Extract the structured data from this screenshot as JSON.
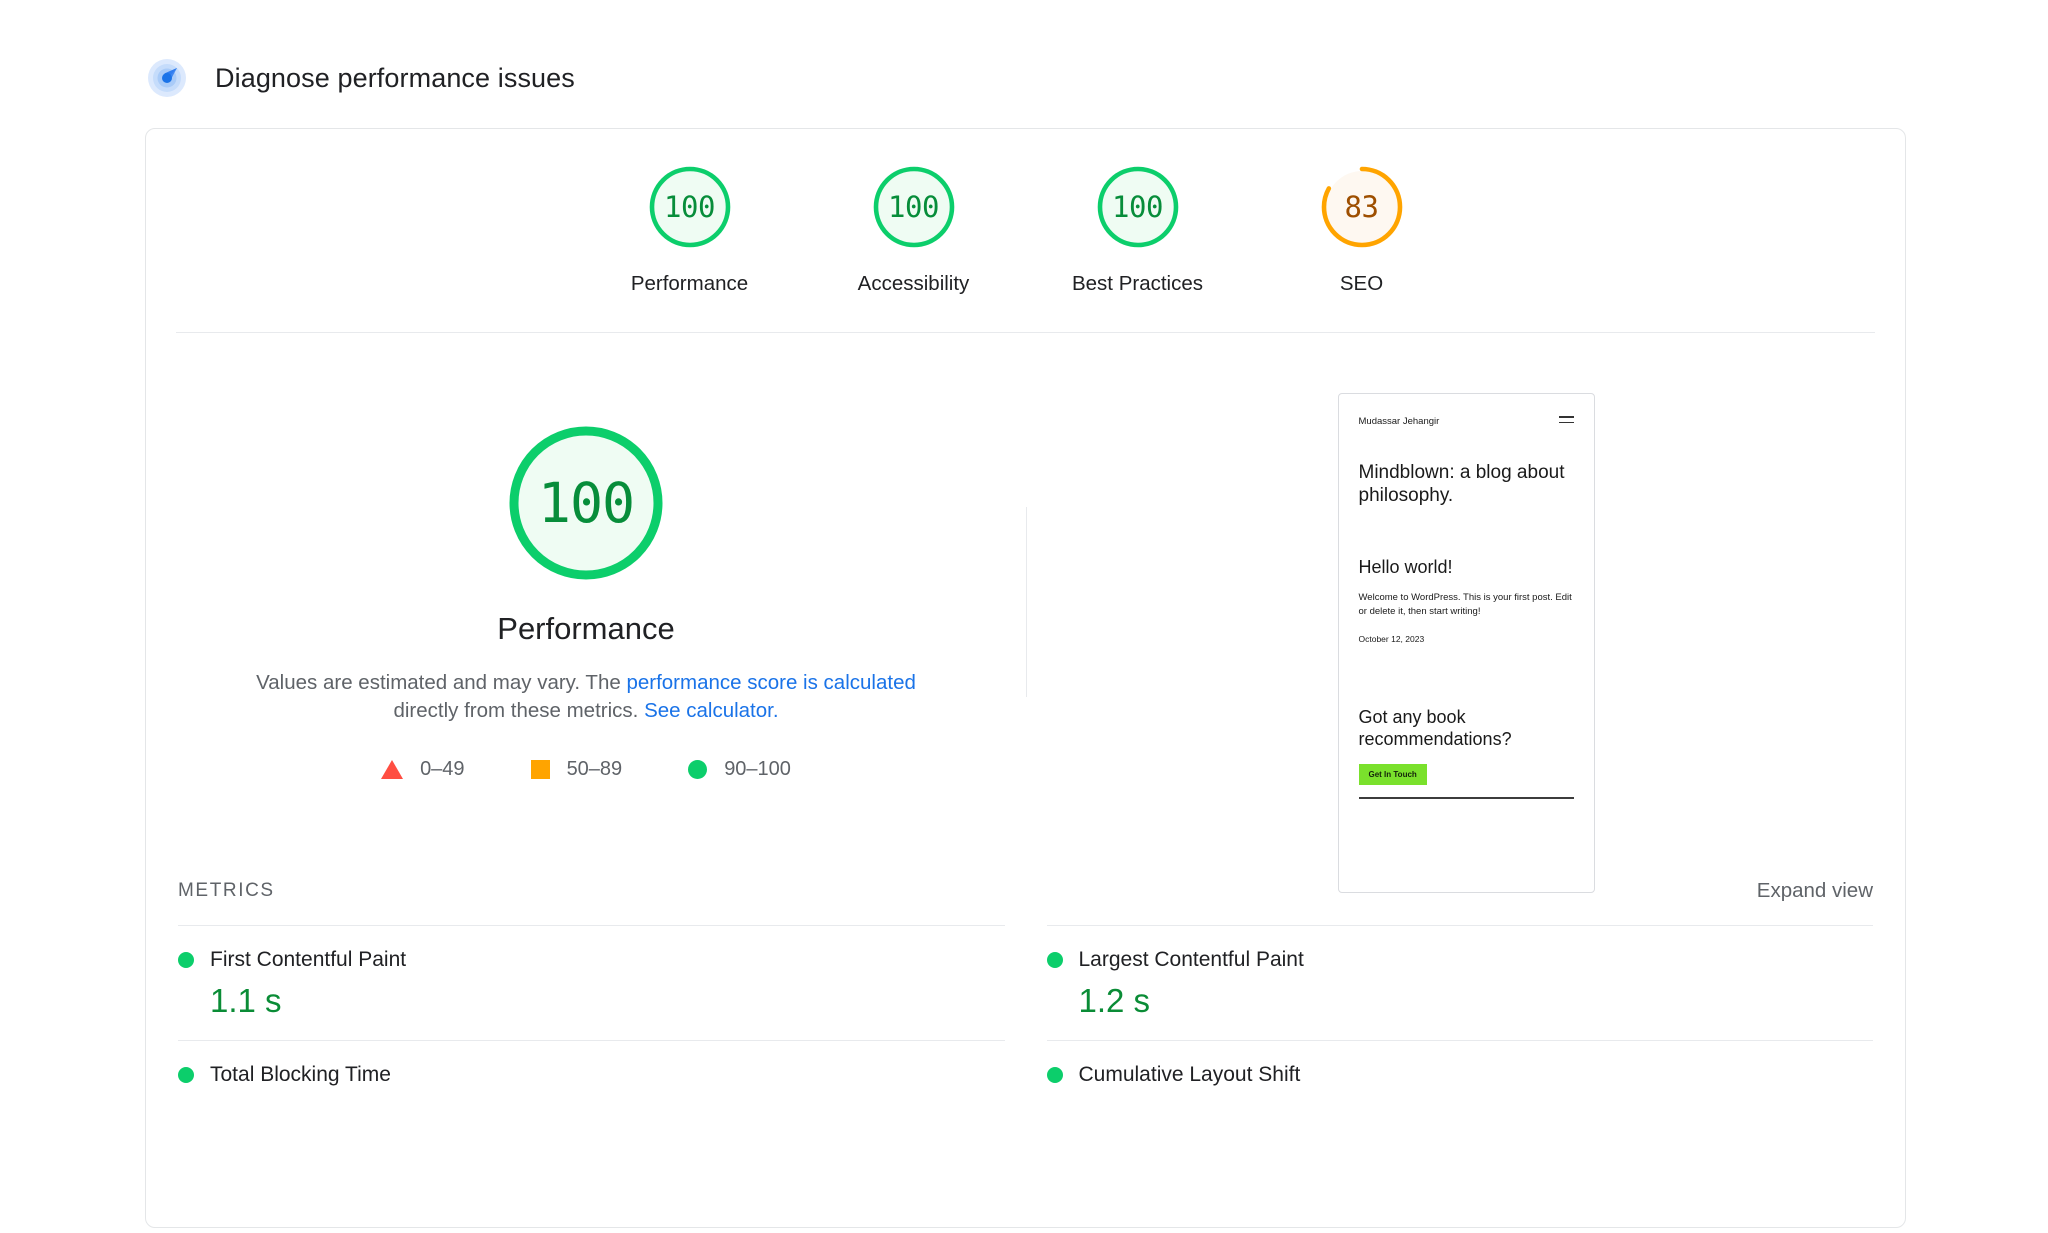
{
  "header": {
    "title": "Diagnose performance issues",
    "icon": "radar-pulse-icon"
  },
  "category_scores": [
    {
      "value": "100",
      "label": "Performance",
      "state": "green",
      "percent": 100
    },
    {
      "value": "100",
      "label": "Accessibility",
      "state": "green",
      "percent": 100
    },
    {
      "value": "100",
      "label": "Best Practices",
      "state": "green",
      "percent": 100
    },
    {
      "value": "83",
      "label": "SEO",
      "state": "orange",
      "percent": 83
    }
  ],
  "main_gauge": {
    "value": "100",
    "label": "Performance",
    "percent": 100,
    "description_pre": "Values are estimated and may vary. The ",
    "link1": "performance score is calculated",
    "description_mid": " directly from these metrics. ",
    "link2": "See calculator.",
    "legend": [
      {
        "shape": "triangle",
        "range": "0–49",
        "color": "#FF4E42"
      },
      {
        "shape": "square",
        "range": "50–89",
        "color": "#FFA400"
      },
      {
        "shape": "circle",
        "range": "90–100",
        "color": "#0CCE6B"
      }
    ]
  },
  "thumbnail": {
    "site_name": "Mudassar Jehangir",
    "menu_icon": "hamburger-icon",
    "heading_1": "Mindblown: a blog about philosophy.",
    "heading_2": "Hello world!",
    "paragraph": "Welcome to WordPress. This is your first post. Edit or delete it, then start writing!",
    "date": "October 12, 2023",
    "heading_3": "Got any book recommendations?",
    "button": "Get In Touch"
  },
  "metrics_section": {
    "title": "METRICS",
    "expand_view": "Expand view",
    "items": [
      {
        "name": "First Contentful Paint",
        "value": "1.1 s",
        "state": "green"
      },
      {
        "name": "Largest Contentful Paint",
        "value": "1.2 s",
        "state": "green"
      },
      {
        "name": "Total Blocking Time",
        "value": "",
        "state": "green"
      },
      {
        "name": "Cumulative Layout Shift",
        "value": "",
        "state": "green"
      }
    ]
  },
  "colors": {
    "pass_green": "#0CCE6B",
    "pass_green_text": "#078D3A",
    "pass_green_bg": "#EFFCF3",
    "average_orange": "#FFA400",
    "average_orange_text": "#9e4f00",
    "average_orange_bg": "#FEF8F1",
    "fail_red": "#FF4E42",
    "link_blue": "#1a73e8"
  }
}
